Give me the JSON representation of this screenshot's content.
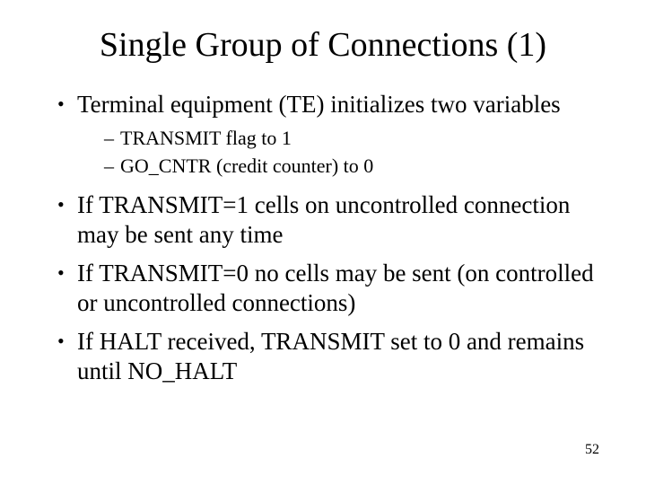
{
  "title": "Single Group of Connections (1)",
  "bullets": [
    {
      "text": "Terminal equipment (TE) initializes two variables",
      "sub": [
        "TRANSMIT flag to 1",
        "GO_CNTR (credit counter) to 0"
      ]
    },
    {
      "text": "If TRANSMIT=1 cells on uncontrolled connection may be sent any time"
    },
    {
      "text": "If TRANSMIT=0 no cells may be sent (on controlled or uncontrolled connections)"
    },
    {
      "text": "If HALT received, TRANSMIT set to 0 and remains until NO_HALT"
    }
  ],
  "page_number": "52"
}
